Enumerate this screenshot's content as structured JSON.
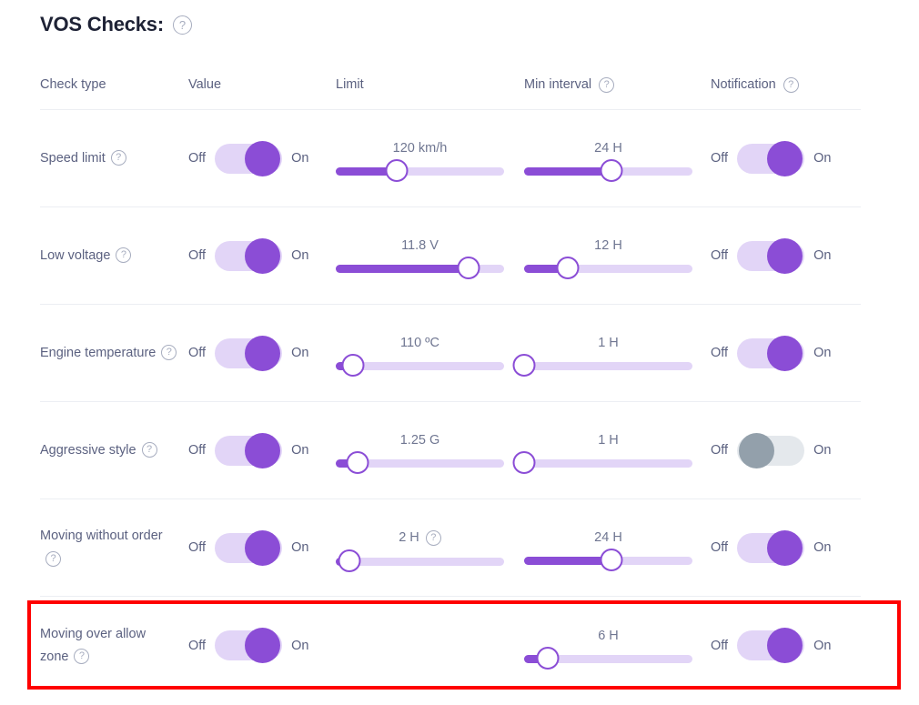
{
  "header": {
    "title": "VOS Checks:",
    "help_icon": "help-circle-icon"
  },
  "columns": {
    "check_type": "Check type",
    "value": "Value",
    "limit": "Limit",
    "min_interval": "Min interval",
    "notification": "Notification"
  },
  "labels": {
    "off": "Off",
    "on": "On"
  },
  "colors": {
    "accent_purple": "#8b4dd6",
    "track_light": "#e2d5f7",
    "disabled_knob": "#93a0ab",
    "disabled_track": "#e4e8ec",
    "text": "#5b6180",
    "title": "#1e2235",
    "highlight_red": "#ff0000",
    "row_divider": "#eceef3"
  },
  "rows": [
    {
      "name": "Speed limit",
      "value_toggle": "on",
      "limit": {
        "label": "120 km/h",
        "percent": 36,
        "has_help": false
      },
      "min_interval": {
        "label": "24 H",
        "percent": 52,
        "has_help": false
      },
      "notification_toggle": "on"
    },
    {
      "name": "Low voltage",
      "value_toggle": "on",
      "limit": {
        "label": "11.8 V",
        "percent": 79,
        "has_help": false
      },
      "min_interval": {
        "label": "12 H",
        "percent": 26,
        "has_help": false
      },
      "notification_toggle": "on"
    },
    {
      "name": "Engine temperature",
      "value_toggle": "on",
      "limit": {
        "label": "110 ºC",
        "percent": 10,
        "has_help": false
      },
      "min_interval": {
        "label": "1 H",
        "percent": 0,
        "has_help": false
      },
      "notification_toggle": "on"
    },
    {
      "name": "Aggressive style",
      "value_toggle": "on",
      "limit": {
        "label": "1.25 G",
        "percent": 13,
        "has_help": false
      },
      "min_interval": {
        "label": "1 H",
        "percent": 0,
        "has_help": false
      },
      "notification_toggle": "off-disabled"
    },
    {
      "name": "Moving without order",
      "value_toggle": "on",
      "limit": {
        "label": "2 H",
        "percent": 8,
        "has_help": true
      },
      "min_interval": {
        "label": "24 H",
        "percent": 52,
        "has_help": false
      },
      "notification_toggle": "on"
    },
    {
      "name": "Moving over allow zone",
      "value_toggle": "on",
      "limit": null,
      "min_interval": {
        "label": "6 H",
        "percent": 14,
        "has_help": false
      },
      "notification_toggle": "on",
      "highlighted": true
    }
  ]
}
